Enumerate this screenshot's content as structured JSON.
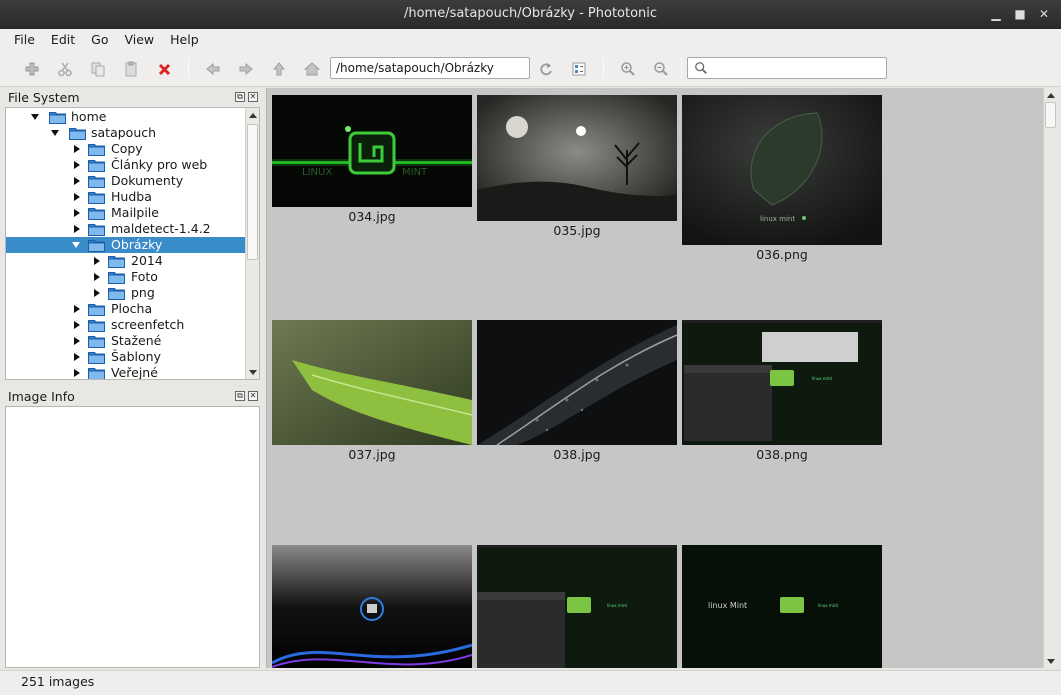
{
  "window": {
    "title": "/home/satapouch/Obrázky - Phototonic"
  },
  "menu": [
    "File",
    "Edit",
    "Go",
    "View",
    "Help"
  ],
  "toolbar": {
    "path_value": "/home/satapouch/Obrázky",
    "search_value": ""
  },
  "filesystem": {
    "title": "File System",
    "items": [
      {
        "label": "home",
        "depth": 0,
        "expanded": true,
        "selected": false
      },
      {
        "label": "satapouch",
        "depth": 1,
        "expanded": true,
        "selected": false
      },
      {
        "label": "Copy",
        "depth": 2,
        "expanded": false,
        "selected": false
      },
      {
        "label": "Články pro web",
        "depth": 2,
        "expanded": false,
        "selected": false
      },
      {
        "label": "Dokumenty",
        "depth": 2,
        "expanded": false,
        "selected": false
      },
      {
        "label": "Hudba",
        "depth": 2,
        "expanded": false,
        "selected": false
      },
      {
        "label": "Mailpile",
        "depth": 2,
        "expanded": false,
        "selected": false
      },
      {
        "label": "maldetect-1.4.2",
        "depth": 2,
        "expanded": false,
        "selected": false
      },
      {
        "label": "Obrázky",
        "depth": 2,
        "expanded": true,
        "selected": true
      },
      {
        "label": "2014",
        "depth": 3,
        "expanded": false,
        "selected": false
      },
      {
        "label": "Foto",
        "depth": 3,
        "expanded": false,
        "selected": false
      },
      {
        "label": "png",
        "depth": 3,
        "expanded": false,
        "selected": false
      },
      {
        "label": "Plocha",
        "depth": 2,
        "expanded": false,
        "selected": false
      },
      {
        "label": "screenfetch",
        "depth": 2,
        "expanded": false,
        "selected": false
      },
      {
        "label": "Stažené",
        "depth": 2,
        "expanded": false,
        "selected": false
      },
      {
        "label": "Šablony",
        "depth": 2,
        "expanded": false,
        "selected": false
      },
      {
        "label": "Veřejné",
        "depth": 2,
        "expanded": false,
        "selected": false
      }
    ]
  },
  "image_info": {
    "title": "Image Info"
  },
  "thumbnails": [
    {
      "name": "034.jpg",
      "kind": "mint-green"
    },
    {
      "name": "035.jpg",
      "kind": "moon-night"
    },
    {
      "name": "036.png",
      "kind": "mint-leaf"
    },
    {
      "name": "037.jpg",
      "kind": "green-leaf"
    },
    {
      "name": "038.jpg",
      "kind": "feather"
    },
    {
      "name": "038.png",
      "kind": "desktop"
    },
    {
      "name": "",
      "kind": "mint-blue"
    },
    {
      "name": "",
      "kind": "desktop2"
    },
    {
      "name": "",
      "kind": "mint-logo"
    }
  ],
  "status": {
    "text": "251 images"
  }
}
